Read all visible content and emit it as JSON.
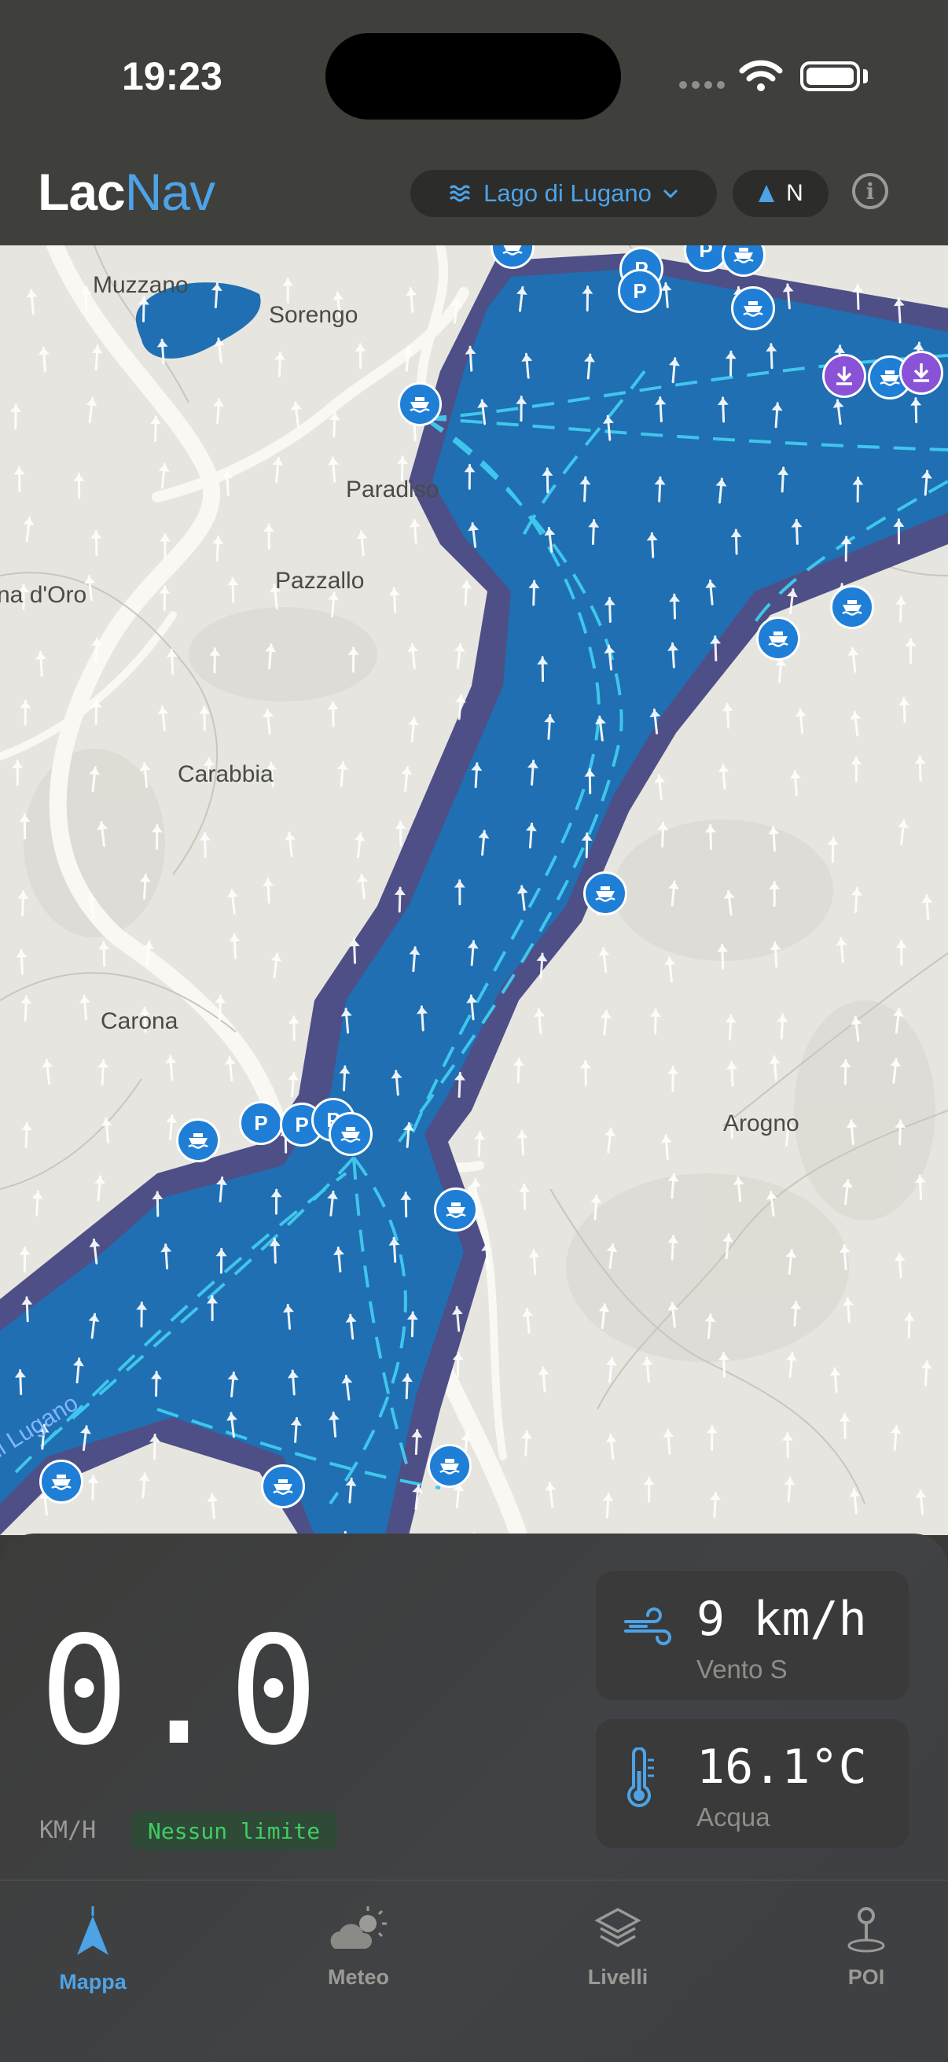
{
  "status_bar": {
    "time": "19:23"
  },
  "header": {
    "logo_part1": "Lac",
    "logo_part2": "Nav",
    "lake_selector": "Lago di Lugano",
    "north_label": "N"
  },
  "map": {
    "labels": [
      "Muzzano",
      "Sorengo",
      "Paradiso",
      "Pazzallo",
      "na d'Oro",
      "Carabbia",
      "Carona",
      "Arogno",
      "di Lugano"
    ],
    "marker_text": {
      "parking": "P"
    },
    "colors": {
      "water": "#1f6fb2",
      "water_edge": "#4e4f86",
      "ferry_route": "#3fc6ec",
      "land": "#e7e5df",
      "road": "#faf8f2",
      "wind_arrow": "#ffffff",
      "marker_blue": "#1f7fd6",
      "marker_purple": "#8a52d6"
    }
  },
  "speed": {
    "value": "0.0",
    "unit": "KM/H",
    "limit": "Nessun limite"
  },
  "wind": {
    "value": "9 km/h",
    "label": "Vento S"
  },
  "water_temp": {
    "value": "16.1°C",
    "label": "Acqua"
  },
  "tabs": [
    {
      "label": "Mappa",
      "icon": "map-arrow-icon",
      "active": true
    },
    {
      "label": "Meteo",
      "icon": "weather-icon",
      "active": false
    },
    {
      "label": "Livelli",
      "icon": "layers-icon",
      "active": false
    },
    {
      "label": "POI",
      "icon": "pin-icon",
      "active": false
    }
  ],
  "colors": {
    "accent": "#4da3e6",
    "limit_text": "#3ecf62"
  }
}
